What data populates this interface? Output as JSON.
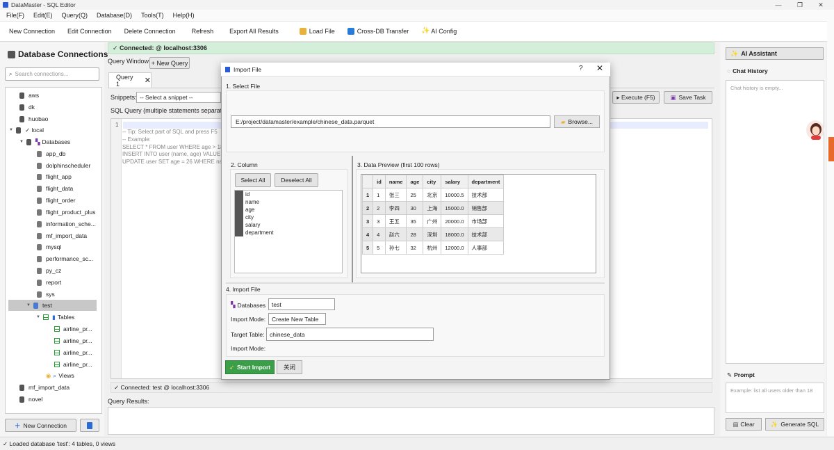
{
  "window": {
    "title": "DataMaster - SQL Editor",
    "min": "—",
    "max": "❐",
    "close": "✕"
  },
  "menu": [
    "File(F)",
    "Edit(E)",
    "Query(Q)",
    "Database(D)",
    "Tools(T)",
    "Help(H)"
  ],
  "toolbar": [
    "New Connection",
    "Edit Connection",
    "Delete Connection",
    "Refresh",
    "Export All Results",
    "Load File",
    "Cross-DB Transfer",
    "AI Config"
  ],
  "left": {
    "title": "Database Connections",
    "search_placeholder": "Search connections...",
    "tree": {
      "aws": "aws",
      "dk": "dk",
      "huobao": "huobao",
      "local": "✓ local",
      "databases": "Databases",
      "dbs": [
        "app_db",
        "dolphinscheduler",
        "flight_app",
        "flight_data",
        "flight_order",
        "flight_product_plus",
        "information_sche...",
        "mf_import_data",
        "mysql",
        "performance_sc...",
        "py_cz",
        "report",
        "sys"
      ],
      "test": "test",
      "tables": "Tables",
      "tbls": [
        "airline_pr...",
        "airline_pr...",
        "airline_pr...",
        "airline_pr..."
      ],
      "views": "Views",
      "mf": "mf_import_data",
      "novel": "novel"
    },
    "new_connection": "New Connection"
  },
  "center": {
    "connected": "✓ Connected:  @ localhost:3306",
    "query_window": "Query Window:",
    "new_query": "+ New Query",
    "tab": "Query 1",
    "snippets_label": "Snippets:",
    "snippets_value": "-- Select a snippet --",
    "sql_label": "SQL Query (multiple statements separated b",
    "line_no": "1",
    "code": [
      "-- Tip: Select part of SQL and press F5",
      "-- Example:",
      "SELECT * FROM user WHERE age > 18;",
      "INSERT INTO user (name, age) VALUES",
      "UPDATE user SET age = 26 WHERE nar"
    ],
    "execute": "▸ Execute (F5)",
    "save": "Save Task",
    "status": "✓ Connected: test @ localhost:3306",
    "results_label": "Query Results:"
  },
  "right": {
    "ai_assistant": "AI Assistant",
    "chat_history": "Chat History",
    "chat_empty": "Chat history is empty...",
    "prompt": "Prompt",
    "prompt_placeholder": "Example: list all users older than 18",
    "clear": "Clear",
    "generate": "Generate SQL"
  },
  "statusbar": "✓ Loaded database 'test': 4 tables, 0 views",
  "dialog": {
    "title": "Import File",
    "help": "?",
    "close": "✕",
    "sec1": "1. Select File",
    "file_path": "E:/project/datamaster/example/chinese_data.parquet",
    "browse": "Browse...",
    "sec2": "2. Column",
    "select_all": "Select All",
    "deselect_all": "Deselect All",
    "columns": [
      "id",
      "name",
      "age",
      "city",
      "salary",
      "department"
    ],
    "sec3": "3. Data Preview (first 100 rows)",
    "preview_headers": [
      "",
      "id",
      "name",
      "age",
      "city",
      "salary",
      "department"
    ],
    "preview_rows": [
      [
        "1",
        "1",
        "张三",
        "25",
        "北京",
        "10000.5",
        "技术部"
      ],
      [
        "2",
        "2",
        "李四",
        "30",
        "上海",
        "15000.0",
        "销售部"
      ],
      [
        "3",
        "3",
        "王五",
        "35",
        "广州",
        "20000.0",
        "市场部"
      ],
      [
        "4",
        "4",
        "赵六",
        "28",
        "深圳",
        "18000.0",
        "技术部"
      ],
      [
        "5",
        "5",
        "孙七",
        "32",
        "杭州",
        "12000.0",
        "人事部"
      ]
    ],
    "sec4": "4. Import File",
    "databases_label": "Databases",
    "databases_value": "test",
    "import_mode_label": "Import Mode:",
    "import_mode_value": "Create New Table",
    "target_label": "Target Table:",
    "target_value": "chinese_data",
    "import_mode_label2": "Import Mode:",
    "start": "Start Import",
    "close_btn": "关闭"
  }
}
